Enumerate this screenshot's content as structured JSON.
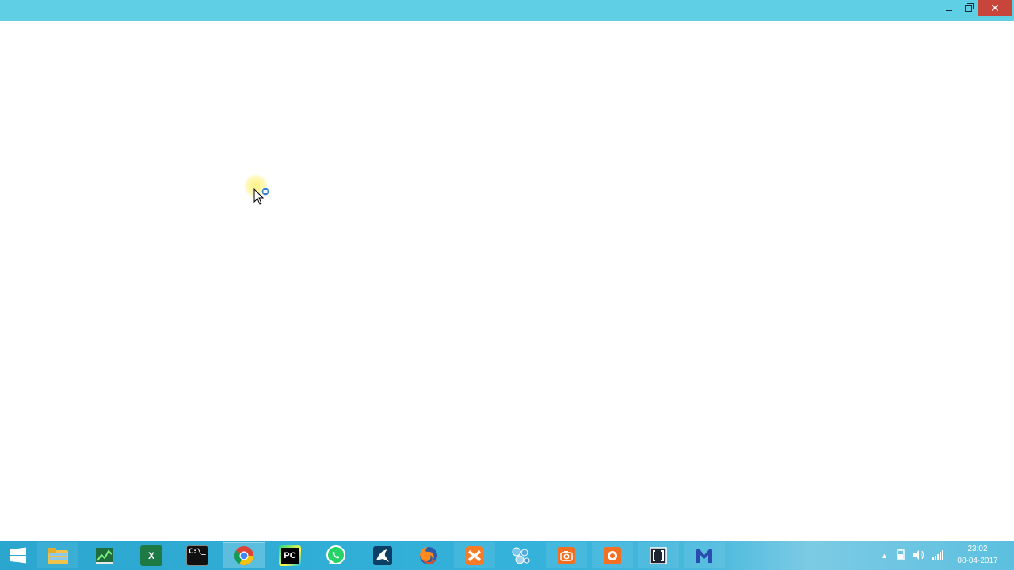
{
  "window": {
    "minimize_symbol": "",
    "close_symbol": "✕"
  },
  "taskbar": {
    "items": [
      {
        "name": "start-button",
        "icon": "windows-logo-icon"
      },
      {
        "name": "file-explorer",
        "icon": "folder-icon"
      },
      {
        "name": "task-manager-app",
        "icon": "chart-icon"
      },
      {
        "name": "excel-app",
        "icon": "excel-icon"
      },
      {
        "name": "command-prompt-app",
        "icon": "terminal-icon"
      },
      {
        "name": "chrome-app",
        "icon": "chrome-icon"
      },
      {
        "name": "pycharm-app",
        "icon": "pycharm-icon"
      },
      {
        "name": "whatsapp-app",
        "icon": "whatsapp-icon"
      },
      {
        "name": "mysql-workbench-app",
        "icon": "dolphin-icon"
      },
      {
        "name": "firefox-app",
        "icon": "firefox-icon"
      },
      {
        "name": "xampp-app",
        "icon": "xampp-icon"
      },
      {
        "name": "network-app",
        "icon": "molecule-icon"
      },
      {
        "name": "screen-capture-app",
        "icon": "camera-icon"
      },
      {
        "name": "screen-recorder-app",
        "icon": "record-icon"
      },
      {
        "name": "brackets-app",
        "icon": "brackets-icon"
      },
      {
        "name": "malwarebytes-app",
        "icon": "malwarebytes-icon"
      }
    ],
    "pycharm_label": "PC",
    "excel_label": "X",
    "terminal_label": "C:\\_"
  },
  "tray": {
    "show_hidden_icon": "chevron-up-icon",
    "time": "23:02",
    "date": "08-04-2017"
  },
  "colors": {
    "titlebar": "#5fcfe6",
    "taskbar": "#2ba6cf",
    "close_button": "#c7453a"
  }
}
